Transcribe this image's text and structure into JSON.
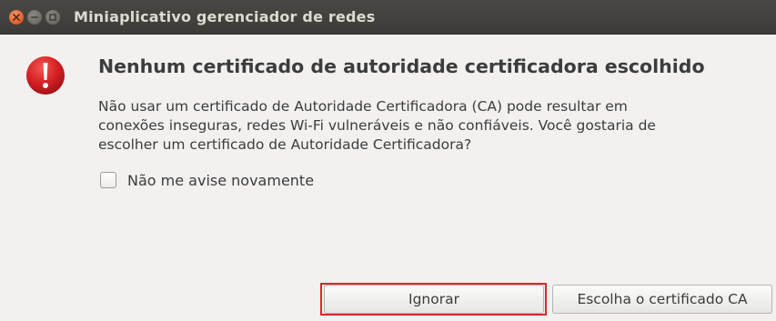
{
  "window": {
    "title": "Miniaplicativo gerenciador de redes",
    "controls": [
      "close-icon",
      "minimize-icon",
      "maximize-icon"
    ]
  },
  "dialog": {
    "icon": "error-icon",
    "heading": "Nenhum certificado de autoridade certificadora escolhido",
    "message_lines": [
      "Não usar um certificado de Autoridade Certificadora (CA) pode resultar em",
      "conexões inseguras, redes Wi-Fi vulneráveis e não confiáveis. Você gostaria de",
      "escolher um certificado de Autoridade Certificadora?"
    ],
    "checkbox": {
      "label": "Não me avise novamente",
      "checked": false
    },
    "buttons": {
      "ignore": "Ignorar",
      "choose_ca": "Escolha o certificado CA"
    }
  },
  "colors": {
    "titlebar": "#3c3b37",
    "close_button": "#e05b25",
    "error_icon": "#d41f23",
    "highlight": "#e0262b",
    "background": "#f2f1f0"
  }
}
